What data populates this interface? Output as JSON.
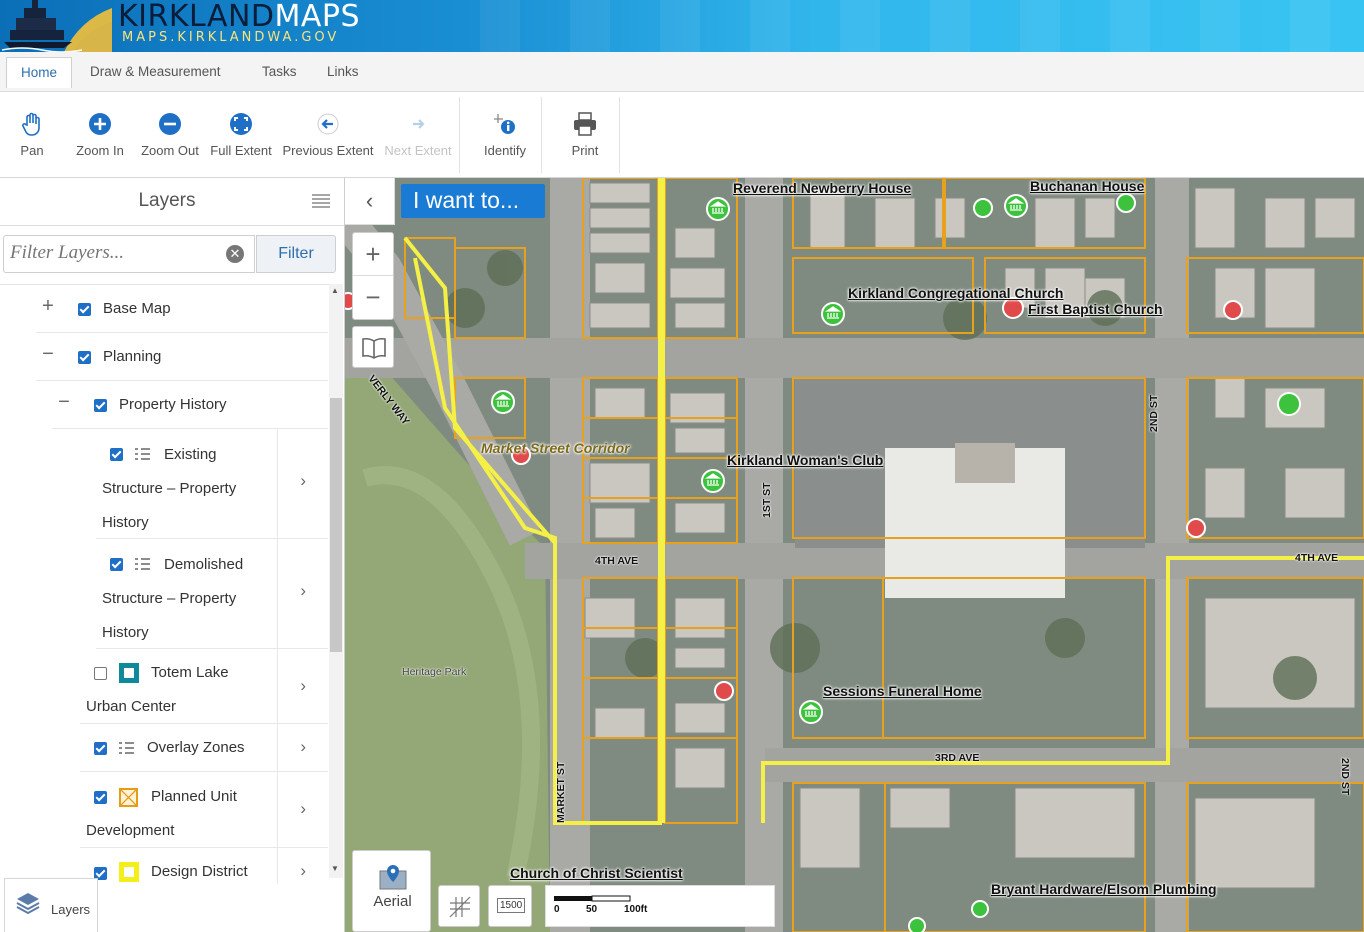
{
  "app": {
    "logo_title_a": "KIRKLAND",
    "logo_title_b": "MAPS",
    "logo_subtitle": "MAPS.KIRKLANDWA.GOV"
  },
  "tabs": [
    {
      "label": "Home",
      "active": true
    },
    {
      "label": "Draw & Measurement",
      "active": false
    },
    {
      "label": "Tasks",
      "active": false
    },
    {
      "label": "Links",
      "active": false
    }
  ],
  "toolbar": {
    "pan": "Pan",
    "zoom_in": "Zoom In",
    "zoom_out": "Zoom Out",
    "full_extent": "Full Extent",
    "previous_extent": "Previous Extent",
    "next_extent": "Next Extent",
    "identify": "Identify",
    "print": "Print"
  },
  "layers_panel": {
    "title": "Layers",
    "filter_placeholder": "Filter Layers...",
    "filter_button": "Filter",
    "items": [
      {
        "label": "Base Map",
        "checked": true,
        "expander": "+"
      },
      {
        "label": "Planning",
        "checked": true,
        "expander": "−"
      },
      {
        "label": "Property History",
        "checked": true,
        "expander": "−"
      },
      {
        "label_1": "Existing",
        "label_2": "Structure – Property",
        "label_3": "History",
        "checked": true
      },
      {
        "label_1": "Demolished",
        "label_2": "Structure – Property",
        "label_3": "History",
        "checked": true
      },
      {
        "label_1": "Totem Lake",
        "label_2": "Urban Center",
        "checked": false
      },
      {
        "label": "Overlay Zones",
        "checked": true
      },
      {
        "label_1": "Planned Unit",
        "label_2": "Development",
        "checked": true
      },
      {
        "label": "Design District",
        "checked": true
      }
    ],
    "bottom_tab": "Layers"
  },
  "map": {
    "i_want_to": "I want to...",
    "aerial_label": "Aerial",
    "scale_labels": [
      "0",
      "50",
      "100ft"
    ],
    "scale_input": "1500",
    "place_labels": [
      "Reverend Newberry House",
      "Buchanan House",
      "Kirkland Congregational Church",
      "First Baptist Church",
      "Kirkland Woman's Club",
      "Sessions Funeral Home",
      "Church of Christ Scientist",
      "Bryant Hardware/Elsom Plumbing",
      "Market Street Corridor"
    ],
    "road_labels": [
      "4TH AVE",
      "4TH AVE",
      "3RD AVE",
      "2ND ST",
      "1ST ST",
      "MARKET ST",
      "VERLY WAY",
      "2ND ST",
      "Heritage Park"
    ]
  },
  "colors": {
    "accent": "#1a7bd4",
    "highlight_yellow": "#f4f046",
    "parcel_orange": "#e8a11c",
    "existing_marker": "#3cc23c",
    "demolished_marker": "#e14a4a"
  }
}
